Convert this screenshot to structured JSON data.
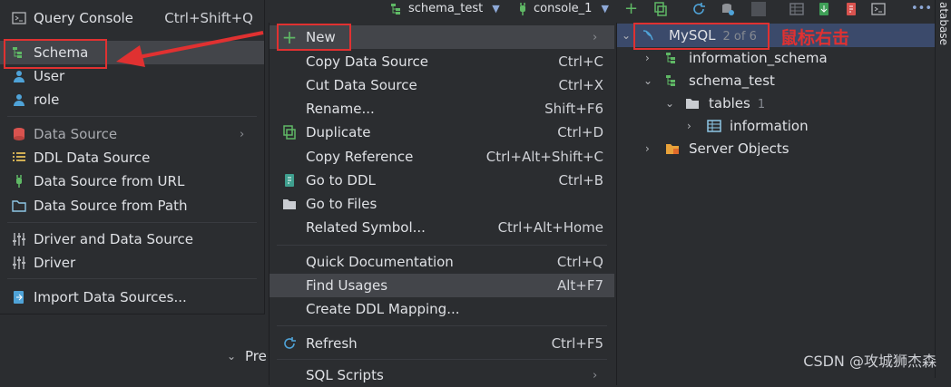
{
  "toolbar": {
    "schema_tab": "schema_test",
    "console_tab": "console_1",
    "more": "•••"
  },
  "side_tab": "atabase",
  "left_menu": {
    "items": [
      {
        "label": "Query Console",
        "shortcut": "Ctrl+Shift+Q"
      },
      {
        "label": "Schema",
        "shortcut": ""
      },
      {
        "label": "User",
        "shortcut": ""
      },
      {
        "label": "role",
        "shortcut": ""
      },
      {
        "label": "Data Source",
        "shortcut": ""
      },
      {
        "label": "DDL Data Source",
        "shortcut": ""
      },
      {
        "label": "Data Source from URL",
        "shortcut": ""
      },
      {
        "label": "Data Source from Path",
        "shortcut": ""
      },
      {
        "label": "Driver and Data Source",
        "shortcut": ""
      },
      {
        "label": "Driver",
        "shortcut": ""
      },
      {
        "label": "Import Data Sources...",
        "shortcut": ""
      }
    ]
  },
  "right_menu": {
    "items": [
      {
        "label": "New",
        "shortcut": ""
      },
      {
        "label": "Copy Data Source",
        "shortcut": "Ctrl+C"
      },
      {
        "label": "Cut Data Source",
        "shortcut": "Ctrl+X"
      },
      {
        "label": "Rename...",
        "shortcut": "Shift+F6"
      },
      {
        "label": "Duplicate",
        "shortcut": "Ctrl+D"
      },
      {
        "label": "Copy Reference",
        "shortcut": "Ctrl+Alt+Shift+C"
      },
      {
        "label": "Go to DDL",
        "shortcut": "Ctrl+B"
      },
      {
        "label": "Go to Files",
        "shortcut": ""
      },
      {
        "label": "Related Symbol...",
        "shortcut": "Ctrl+Alt+Home"
      },
      {
        "label": "Quick Documentation",
        "shortcut": "Ctrl+Q"
      },
      {
        "label": "Find Usages",
        "shortcut": "Alt+F7"
      },
      {
        "label": "Create DDL Mapping...",
        "shortcut": ""
      },
      {
        "label": "Refresh",
        "shortcut": "Ctrl+F5"
      },
      {
        "label": "SQL Scripts",
        "shortcut": ""
      }
    ]
  },
  "tree": {
    "root": {
      "label": "MySQL",
      "count": "2 of 6"
    },
    "nodes": [
      {
        "label": "information_schema"
      },
      {
        "label": "schema_test"
      },
      {
        "label": "tables",
        "count": "1"
      },
      {
        "label": "information"
      },
      {
        "label": "Server Objects"
      }
    ]
  },
  "annotation": "鼠标右击",
  "behind_text": {
    "preview": "Pre"
  },
  "watermark": "CSDN @攻城狮杰森",
  "colors": {
    "highlight": "#e03131",
    "selection": "#3b4a6b",
    "accent_green": "#5fb865"
  }
}
